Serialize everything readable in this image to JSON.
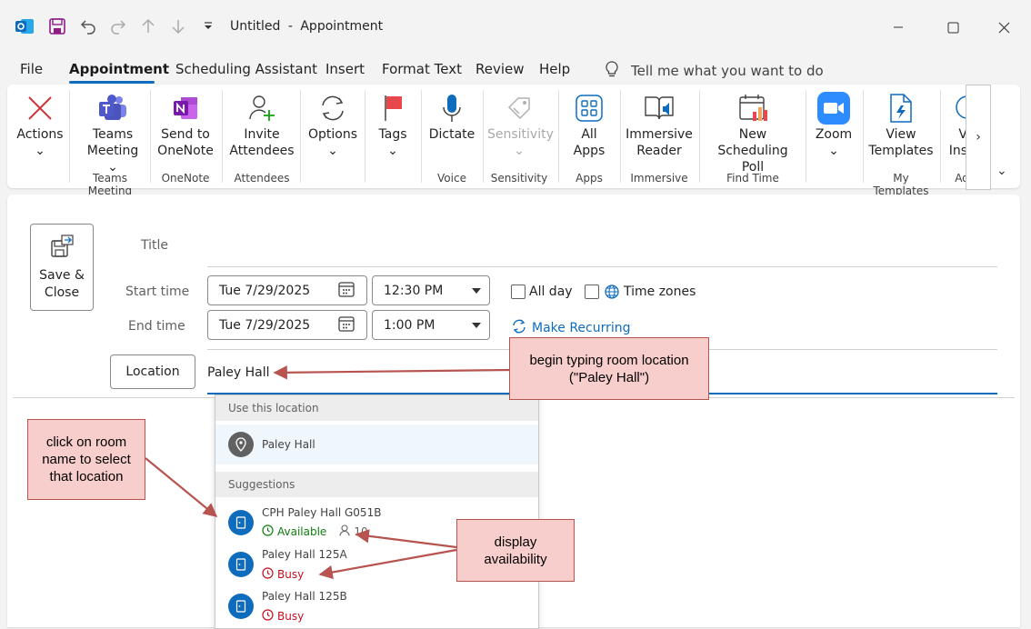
{
  "titlebar": {
    "title": "Untitled",
    "separator": "-",
    "subtitle": "Appointment",
    "icons": [
      "outlook-logo-icon",
      "save-icon",
      "undo-icon",
      "redo-icon",
      "up-arrow-icon",
      "down-arrow-icon",
      "customize-qat-icon"
    ],
    "window_controls": [
      "minimize-icon",
      "maximize-icon",
      "close-icon"
    ]
  },
  "menu": {
    "items": [
      "File",
      "Appointment",
      "Scheduling Assistant",
      "Insert",
      "Format Text",
      "Review",
      "Help"
    ],
    "active": "Appointment",
    "tell_me": "Tell me what you want to do"
  },
  "ribbon": {
    "buttons": [
      {
        "line1": "Actions",
        "line2": "⌄",
        "icon": "x-icon"
      },
      {
        "line1": "Teams",
        "line2": "Meeting ⌄",
        "icon": "teams-icon"
      },
      {
        "line1": "Send to",
        "line2": "OneNote",
        "icon": "onenote-icon"
      },
      {
        "line1": "Invite",
        "line2": "Attendees",
        "icon": "invite-attendees-icon"
      },
      {
        "line1": "Options",
        "line2": "⌄",
        "icon": "options-icon"
      },
      {
        "line1": "Tags",
        "line2": "⌄",
        "icon": "tags-flag-icon"
      },
      {
        "line1": "Dictate",
        "line2": "",
        "icon": "microphone-icon"
      },
      {
        "line1": "Sensitivity",
        "line2": "⌄",
        "icon": "sensitivity-icon",
        "disabled": true
      },
      {
        "line1": "All",
        "line2": "Apps",
        "icon": "apps-grid-icon"
      },
      {
        "line1": "Immersive",
        "line2": "Reader",
        "icon": "immersive-reader-icon"
      },
      {
        "line1": "New",
        "line2": "Scheduling Poll",
        "icon": "scheduling-poll-icon"
      },
      {
        "line1": "Zoom",
        "line2": "⌄",
        "icon": "zoom-icon"
      },
      {
        "line1": "View",
        "line2": "Templates",
        "icon": "templates-icon"
      },
      {
        "line1": "V",
        "line2": "Ins",
        "icon": "insights-icon"
      }
    ],
    "groups": [
      "Teams Meeting",
      "OneNote",
      "Attendees",
      "Voice",
      "Sensitivity",
      "Apps",
      "Immersive",
      "Find Time",
      "My Templates",
      "Ad"
    ],
    "scroll_label": "›",
    "collapse_label": "⌄"
  },
  "form": {
    "save_close_line1": "Save &",
    "save_close_line2": "Close",
    "title_label": "Title",
    "start_label": "Start time",
    "end_label": "End time",
    "start_date": "Tue 7/29/2025",
    "start_time": "12:30 PM",
    "end_date": "Tue 7/29/2025",
    "end_time": "1:00 PM",
    "all_day": "All day",
    "time_zones": "Time zones",
    "make_recurring": "Make Recurring",
    "location_button": "Location",
    "location_value": "Paley Hall"
  },
  "dropdown": {
    "use_header": "Use this location",
    "use_item": "Paley Hall",
    "suggestions_header": "Suggestions",
    "rooms": [
      {
        "name": "CPH Paley Hall G051B",
        "status": "Available",
        "capacity": "10"
      },
      {
        "name": "Paley Hall 125A",
        "status": "Busy"
      },
      {
        "name": "Paley Hall 125B",
        "status": "Busy"
      }
    ]
  },
  "callouts": {
    "typing_line1": "begin typing room location",
    "typing_line2": "(\"Paley Hall\")",
    "click_line1": "click on room",
    "click_line2": "name to select",
    "click_line3": "that location",
    "avail_line1": "display",
    "avail_line2": "availability"
  },
  "colors": {
    "accent": "#0f6cbd",
    "available": "#107c10",
    "busy": "#c50f1f",
    "callout_fill": "#f8cecc",
    "callout_border": "#b85450",
    "arrow": "#b85450"
  }
}
